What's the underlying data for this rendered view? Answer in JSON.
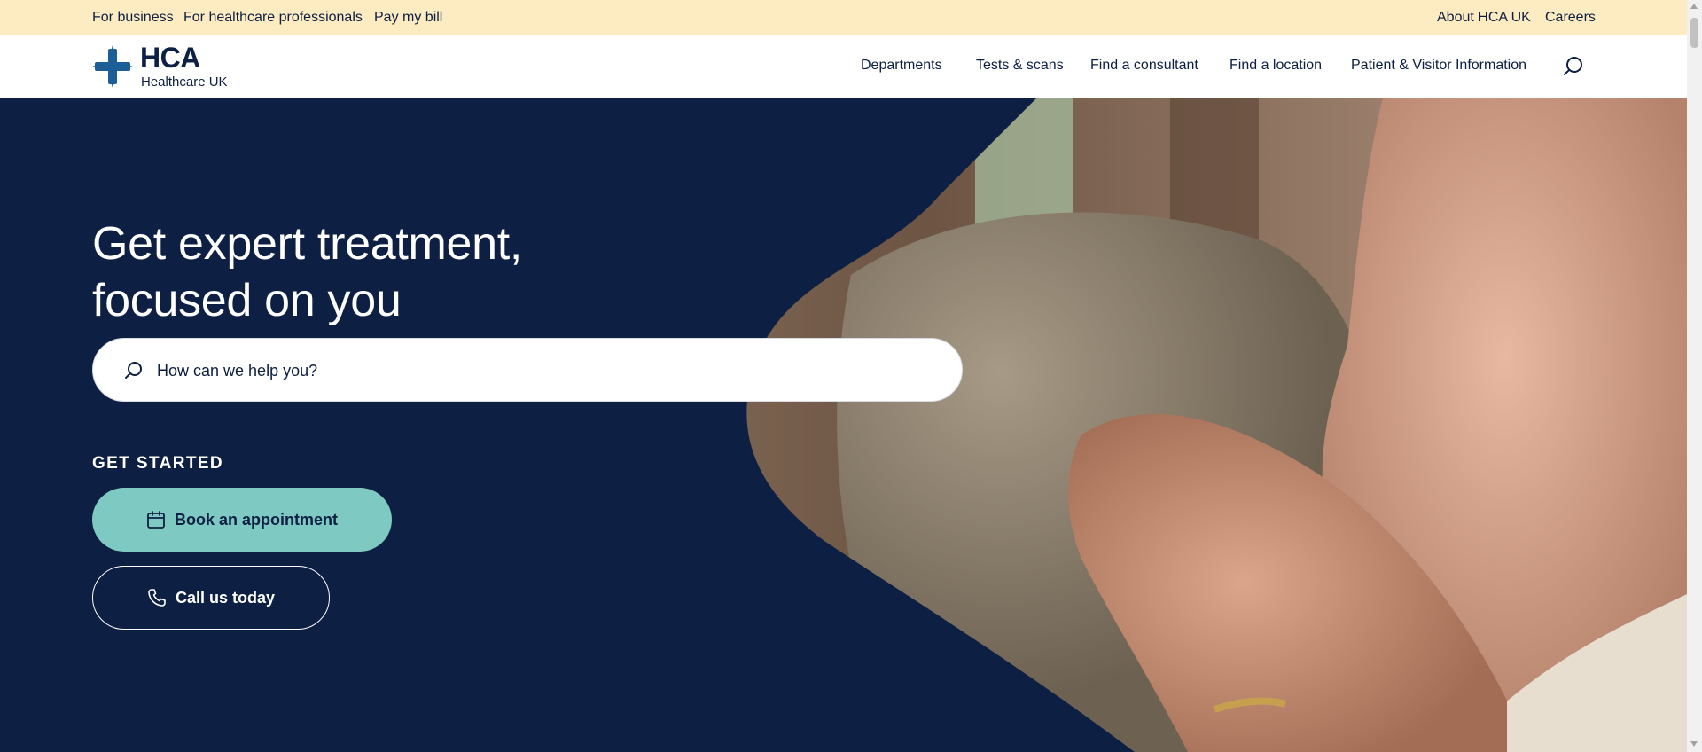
{
  "utility_bar": {
    "left_links": [
      "For business",
      "For healthcare professionals",
      "Pay my bill"
    ],
    "right_links": [
      "About HCA UK",
      "Careers"
    ]
  },
  "header": {
    "logo_word": "HCA",
    "logo_sub": "Healthcare UK",
    "nav": [
      "Departments",
      "Tests & scans",
      "Find a consultant",
      "Find a location",
      "Patient & Visitor Information"
    ],
    "search_icon": "search-icon"
  },
  "hero": {
    "title_line1": "Get expert treatment,",
    "title_line2": "focused on you",
    "search_placeholder": "How can we help you?",
    "get_started_label": "GET STARTED",
    "book_label": "Book an appointment",
    "book_icon": "calendar-icon",
    "call_label": "Call us today",
    "call_icon": "phone-icon"
  },
  "colors": {
    "navy": "#0d1f42",
    "utility_bg": "#fdebc2",
    "teal": "#7ecac3"
  }
}
